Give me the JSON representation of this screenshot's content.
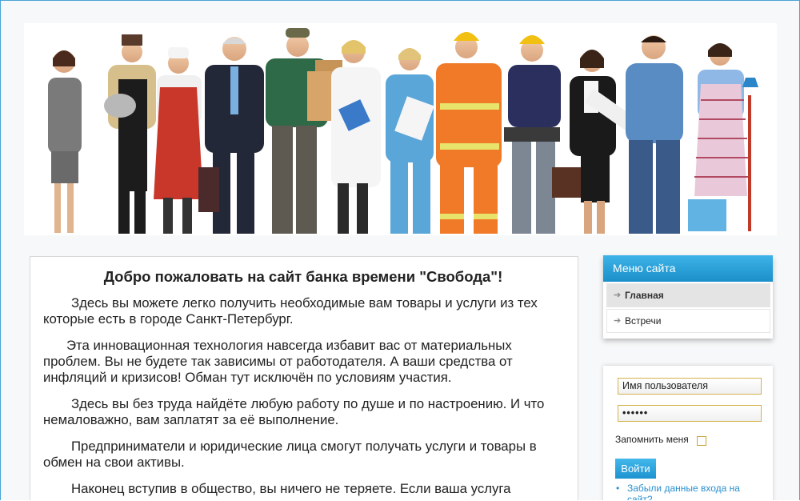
{
  "main": {
    "title": "Добро пожаловать на сайт банка времени \"Свобода\"!",
    "paragraphs": [
      "Здесь вы можете легко получить необходимые вам товары и услуги из тех которые есть в городе Санкт-Петербург.",
      "Эта инновационная технология навсегда избавит вас от материальных проблем. Вы не будете так зависимы от работодателя. А ваши средства от инфляций и кризисов! Обман тут исключён по условиям участия.",
      "Здесь вы без труда найдёте любую работу по душе и по настроению. И что немаловажно, вам заплатят за её выполнение.",
      "Предприниматели и юридические лица смогут получать услуги и товары в обмен на свои активы.",
      "Наконец вступив в общество, вы ничего не теряете. Если ваша услуга"
    ]
  },
  "menu": {
    "title": "Меню сайта",
    "items": [
      {
        "label": "Главная",
        "active": true
      },
      {
        "label": "Встречи",
        "active": false
      }
    ]
  },
  "login": {
    "username_value": "Имя пользователя",
    "password_value": "••••••",
    "remember_label": "Запомнить меня",
    "submit_label": "Войти",
    "forgot_link": "Забыли данные входа на сайт?"
  },
  "colors": {
    "accent": "#1a8fc9",
    "field_border": "#d4b24c",
    "frame_border": "#4aa3d6"
  }
}
